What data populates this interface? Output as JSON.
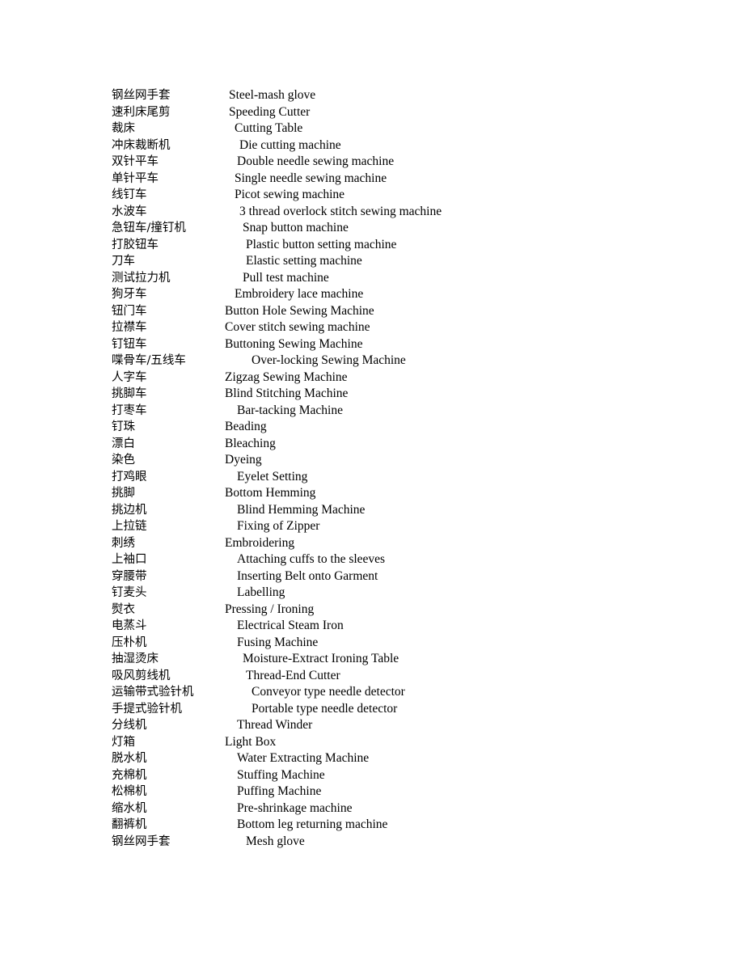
{
  "page": {
    "background_color": "#ffffff",
    "text_color": "#000000"
  },
  "glossary": {
    "rows": [
      {
        "cn": "钢丝网手套",
        "en": "Steel-mash glove",
        "indent": 1
      },
      {
        "cn": "速利床尾剪",
        "en": "Speeding Cutter",
        "indent": 1
      },
      {
        "cn": "裁床",
        "en": "Cutting Table",
        "indent": 3
      },
      {
        "cn": "冲床裁断机",
        "en": "Die cutting machine",
        "indent": 5
      },
      {
        "cn": "双针平车",
        "en": "Double needle sewing machine",
        "indent": 4
      },
      {
        "cn": "单针平车",
        "en": "Single needle sewing machine",
        "indent": 3
      },
      {
        "cn": "线钉车",
        "en": "Picot sewing machine",
        "indent": 3
      },
      {
        "cn": "水波车",
        "en": "3 thread overlock stitch sewing machine",
        "indent": 5
      },
      {
        "cn": "急钮车/撞钉机",
        "en": "Snap button machine",
        "indent": 6
      },
      {
        "cn": "打胶钮车",
        "en": "Plastic button setting machine",
        "indent": 7
      },
      {
        "cn": "刀车",
        "en": "Elastic setting machine",
        "indent": 7
      },
      {
        "cn": "测试拉力机",
        "en": "Pull test machine",
        "indent": 6
      },
      {
        "cn": "狗牙车",
        "en": "Embroidery lace machine",
        "indent": 3
      },
      {
        "cn": "钮门车",
        "en": "Button Hole Sewing Machine",
        "indent": 0
      },
      {
        "cn": "拉襟车",
        "en": "Cover stitch sewing machine",
        "indent": 0
      },
      {
        "cn": "钉钮车",
        "en": "Buttoning Sewing Machine",
        "indent": 0
      },
      {
        "cn": "喋骨车/五线车",
        "en": "Over-locking Sewing Machine",
        "indent": 8
      },
      {
        "cn": "人字车",
        "en": "Zigzag Sewing Machine",
        "indent": 0
      },
      {
        "cn": "挑脚车",
        "en": "Blind Stitching Machine",
        "indent": 0
      },
      {
        "cn": "打枣车",
        "en": "Bar-tacking Machine",
        "indent": 4
      },
      {
        "cn": "钉珠",
        "en": "Beading",
        "indent": 0
      },
      {
        "cn": "漂白",
        "en": "Bleaching",
        "indent": 0
      },
      {
        "cn": "染色",
        "en": "Dyeing",
        "indent": 0
      },
      {
        "cn": "打鸡眼",
        "en": "Eyelet Setting",
        "indent": 4
      },
      {
        "cn": "挑脚",
        "en": "Bottom Hemming",
        "indent": 0
      },
      {
        "cn": "挑边机",
        "en": "Blind Hemming Machine",
        "indent": 4
      },
      {
        "cn": "上拉链",
        "en": "Fixing of Zipper",
        "indent": 4
      },
      {
        "cn": "刺绣",
        "en": "Embroidering",
        "indent": 0
      },
      {
        "cn": "上袖口",
        "en": "Attaching cuffs to the sleeves",
        "indent": 4
      },
      {
        "cn": "穿腰带",
        "en": "Inserting Belt onto Garment",
        "indent": 4
      },
      {
        "cn": "钉麦头",
        "en": "Labelling",
        "indent": 4
      },
      {
        "cn": "熨衣",
        "en": "Pressing / Ironing",
        "indent": 0
      },
      {
        "cn": "电蒸斗",
        "en": "Electrical Steam Iron",
        "indent": 4
      },
      {
        "cn": "压朴机",
        "en": "Fusing Machine",
        "indent": 4
      },
      {
        "cn": "抽湿烫床",
        "en": "Moisture-Extract Ironing Table",
        "indent": 6
      },
      {
        "cn": "吸风剪线机",
        "en": "Thread-End Cutter",
        "indent": 7
      },
      {
        "cn": "运输带式验针机",
        "en": "Conveyor type needle detector",
        "indent": 8
      },
      {
        "cn": "手提式验针机",
        "en": "Portable type needle detector",
        "indent": 8
      },
      {
        "cn": "分线机",
        "en": "Thread Winder",
        "indent": 4
      },
      {
        "cn": "灯箱",
        "en": "Light Box",
        "indent": 0
      },
      {
        "cn": "脱水机",
        "en": "Water Extracting Machine",
        "indent": 4
      },
      {
        "cn": "充棉机",
        "en": "Stuffing Machine",
        "indent": 4
      },
      {
        "cn": "松棉机",
        "en": "Puffing Machine",
        "indent": 4
      },
      {
        "cn": "缩水机",
        "en": "Pre-shrinkage machine",
        "indent": 4
      },
      {
        "cn": "翻裤机",
        "en": "Bottom leg returning machine",
        "indent": 4
      },
      {
        "cn": "钢丝网手套",
        "en": "Mesh glove",
        "indent": 7
      }
    ]
  }
}
